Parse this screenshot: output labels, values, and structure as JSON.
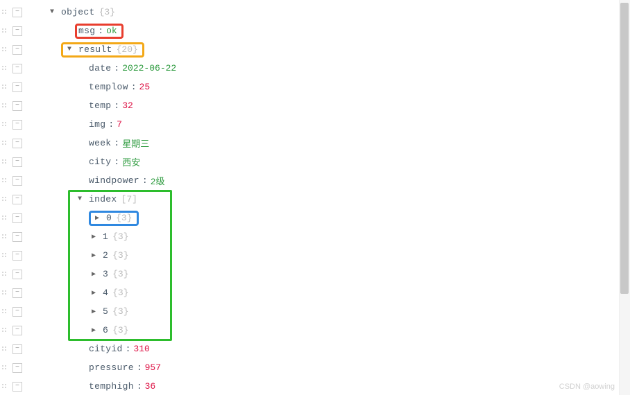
{
  "root": {
    "key": "object",
    "meta": "{3}"
  },
  "msg": {
    "key": "msg",
    "val": "ok"
  },
  "result": {
    "key": "result",
    "meta": "{20}"
  },
  "fields": {
    "date": {
      "key": "date",
      "val": "2022-06-22",
      "type": "str"
    },
    "templow": {
      "key": "templow",
      "val": "25",
      "type": "num"
    },
    "temp": {
      "key": "temp",
      "val": "32",
      "type": "num"
    },
    "img": {
      "key": "img",
      "val": "7",
      "type": "num"
    },
    "week": {
      "key": "week",
      "val": "星期三",
      "type": "str"
    },
    "city": {
      "key": "city",
      "val": "西安",
      "type": "str"
    },
    "windpower": {
      "key": "windpower",
      "val": "2级",
      "type": "str"
    },
    "cityid": {
      "key": "cityid",
      "val": "310",
      "type": "num"
    },
    "pressure": {
      "key": "pressure",
      "val": "957",
      "type": "num"
    },
    "temphigh": {
      "key": "temphigh",
      "val": "36",
      "type": "num"
    }
  },
  "index": {
    "key": "index",
    "meta": "[7]"
  },
  "indexItems": [
    {
      "key": "0",
      "meta": "{3}"
    },
    {
      "key": "1",
      "meta": "{3}"
    },
    {
      "key": "2",
      "meta": "{3}"
    },
    {
      "key": "3",
      "meta": "{3}"
    },
    {
      "key": "4",
      "meta": "{3}"
    },
    {
      "key": "5",
      "meta": "{3}"
    },
    {
      "key": "6",
      "meta": "{3}"
    }
  ],
  "watermark": "CSDN @aowing"
}
